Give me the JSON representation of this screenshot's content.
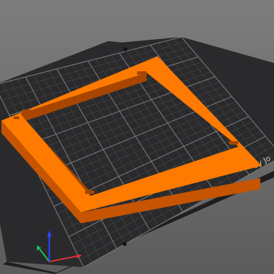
{
  "viewport": {
    "background_color": "#6f6f6f"
  },
  "build_plate": {
    "plate_color": "#2a2a2c",
    "grid_minor_color": "#4a4a4c",
    "grid_major_color": "#7a7a7c",
    "edge_color": "#1e1e20",
    "logo_text": "by Jo"
  },
  "model": {
    "name": "square-frame",
    "top_color": "#ff7a00",
    "side_color": "#c65400",
    "inner_wall_color": "#a84500"
  },
  "axes_gizmo": {
    "x_color": "#e0303a",
    "y_color": "#1ec25a",
    "z_color": "#2b46ff"
  }
}
